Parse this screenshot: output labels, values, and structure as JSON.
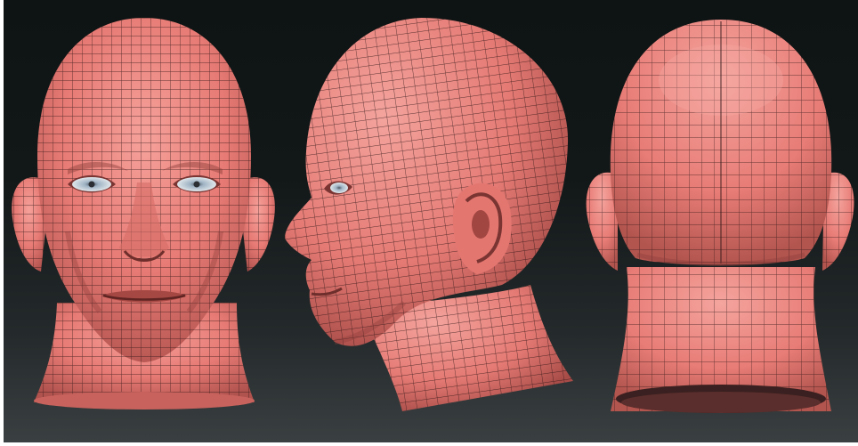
{
  "scene": {
    "views": [
      {
        "id": "front",
        "icon": "head-front-view-icon"
      },
      {
        "id": "side",
        "icon": "head-side-view-icon"
      },
      {
        "id": "back",
        "icon": "head-back-view-icon"
      }
    ]
  },
  "colors": {
    "background_top": "#0e1313",
    "background_bottom": "#3a4041",
    "skin": "#ea7c77",
    "skin_light": "#f4a09a",
    "skin_shadow": "#b4534f",
    "wire": "#2a1414",
    "eye_iris": "#9fb3c4",
    "eye_white": "#dfe6ea"
  }
}
